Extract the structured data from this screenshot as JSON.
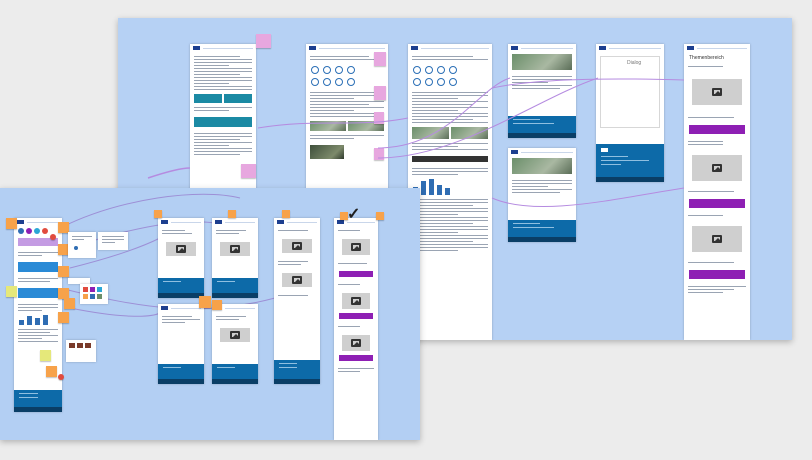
{
  "canvas": {
    "background": "#ececec",
    "board_color": "#b6d1f4",
    "accent_purple": "#8e1fb4",
    "footer_blue": "#0d6aa8",
    "sticky_orange": "#f7a24a",
    "sticky_pink": "#e7a7df",
    "connector_color": "#b58be0"
  },
  "top_board": {
    "dialog_frame": {
      "header_text": "Dialog"
    },
    "section_heading": "Themenbereich",
    "checkmark": "✓"
  },
  "icons": {
    "image_placeholder": "image-placeholder-icon",
    "checkmark": "checkmark-icon"
  }
}
